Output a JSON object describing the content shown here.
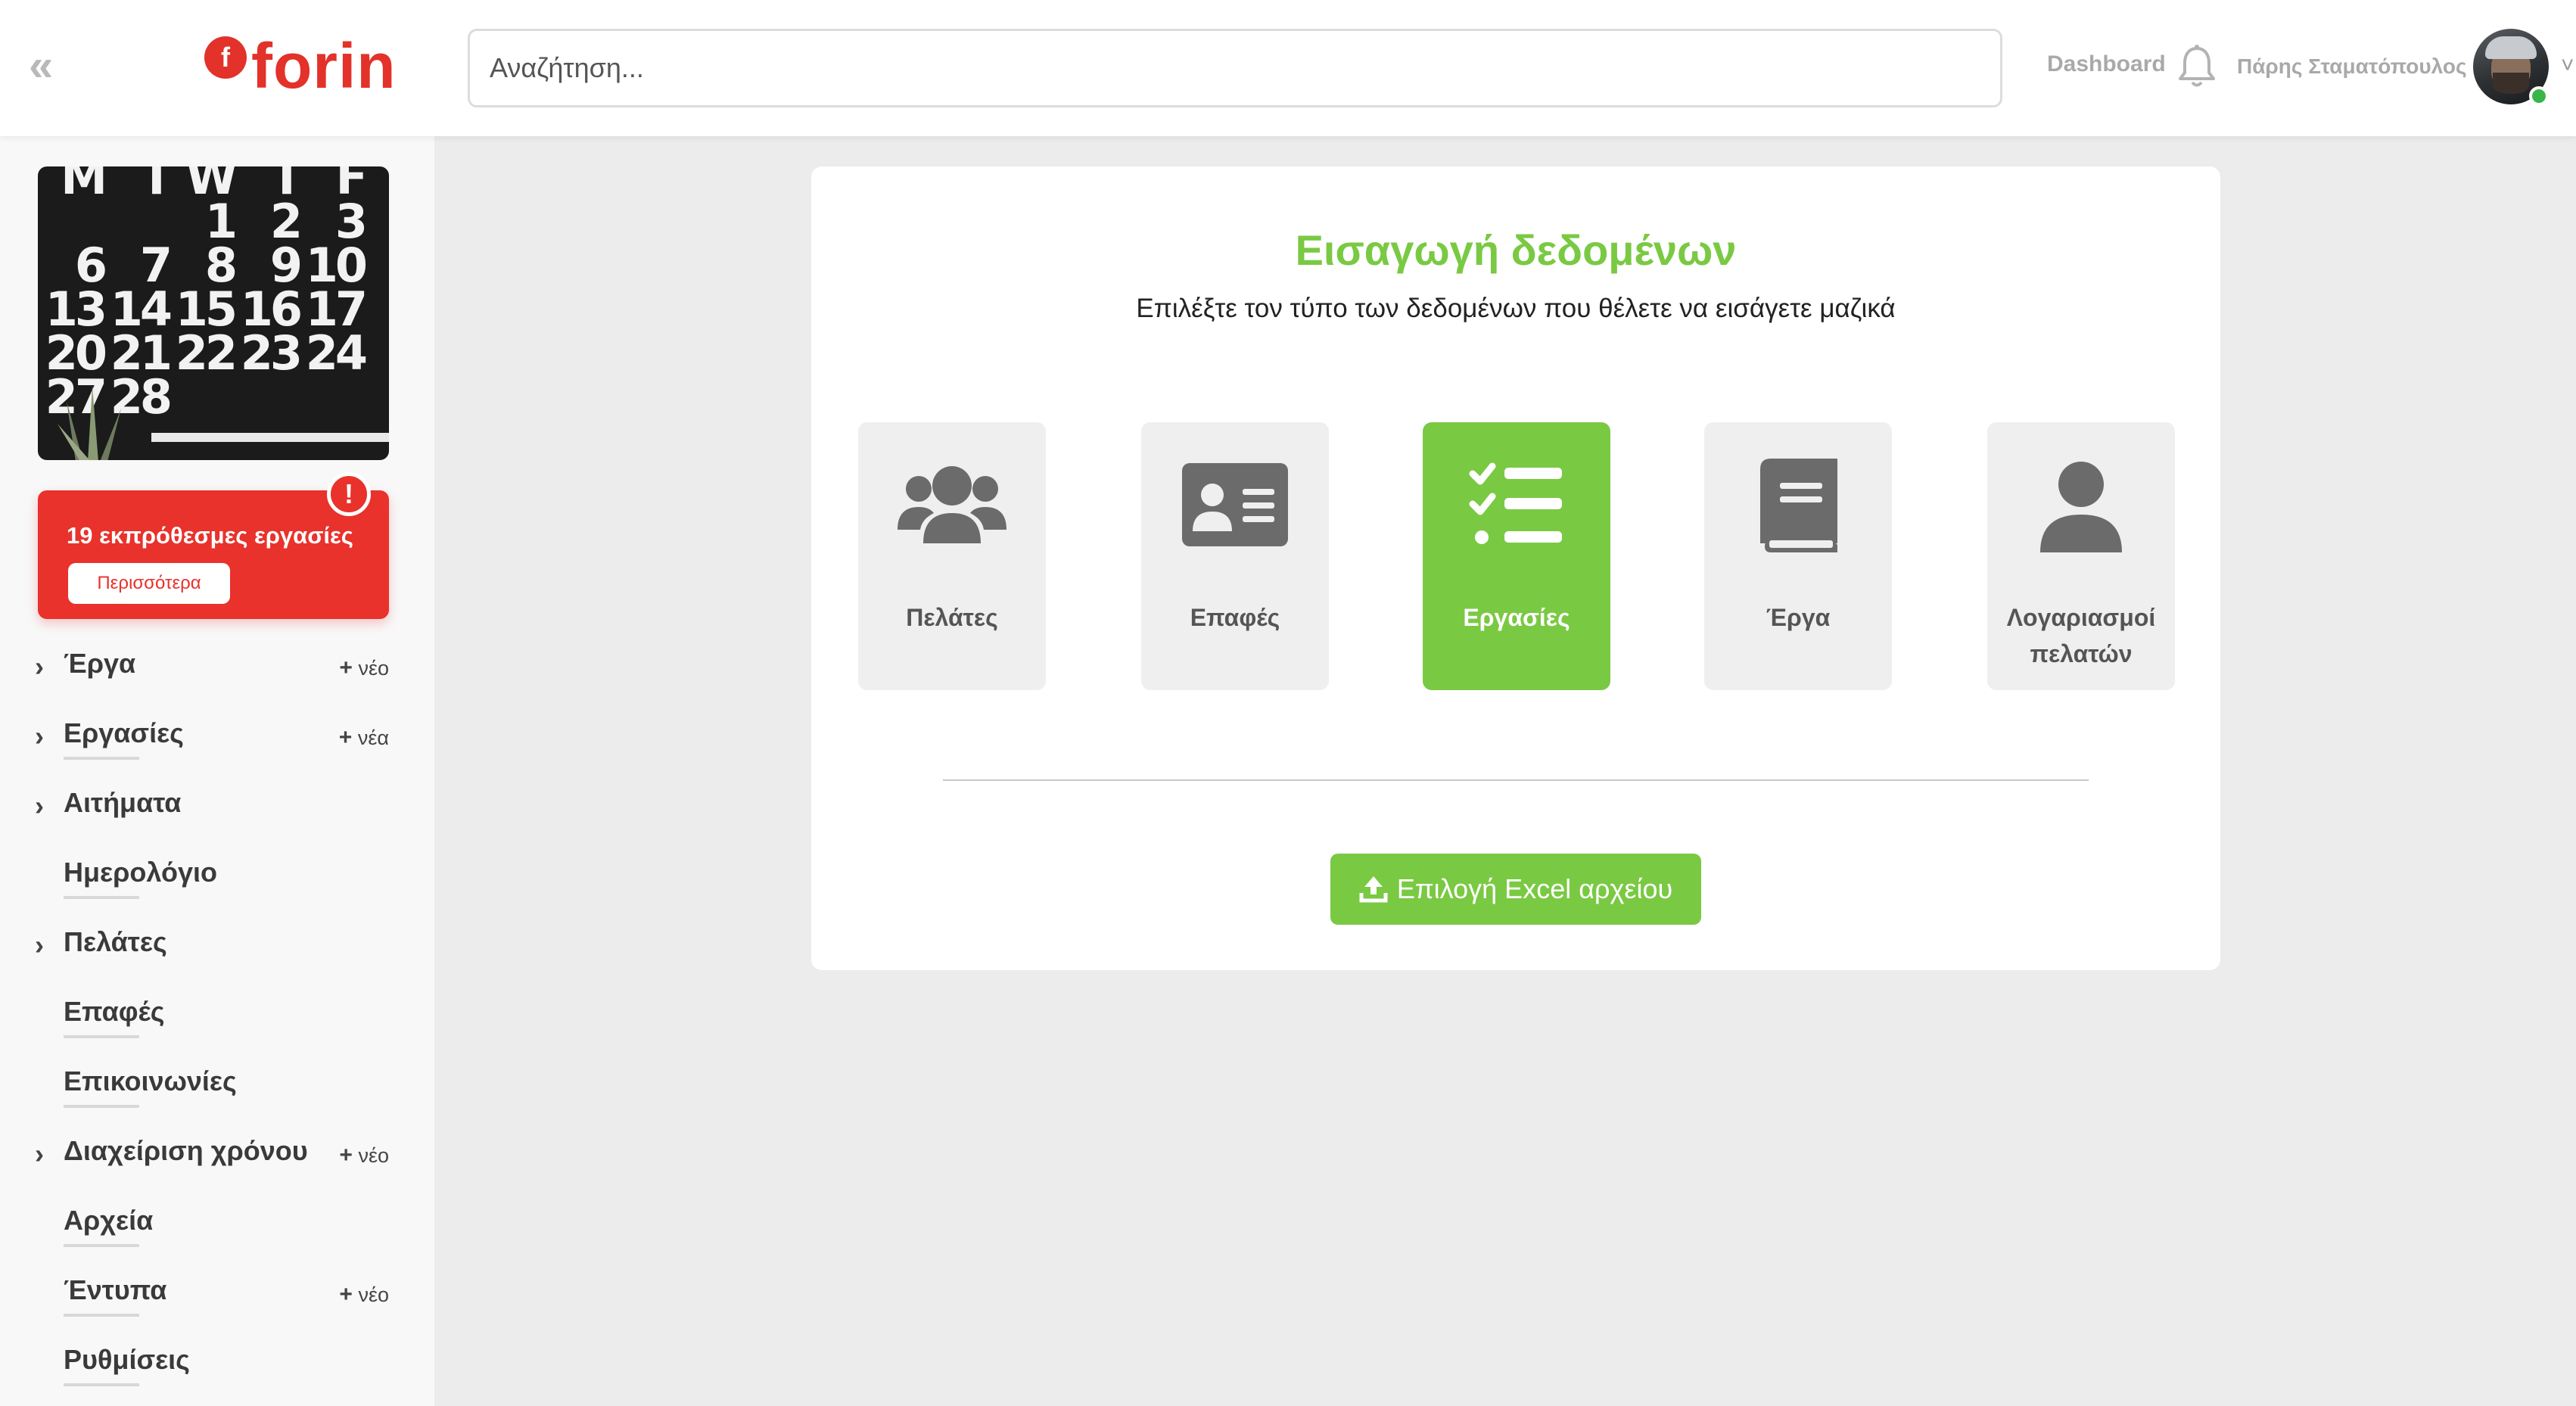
{
  "header": {
    "collapse_icon": "double-chevron-left-icon",
    "logo_mark": "f",
    "logo_text": "forin",
    "search_placeholder": "Αναζήτηση...",
    "dashboard_link": "Dashboard",
    "user_name": "Πάρης Σταματόπουλος",
    "caret": "˅"
  },
  "sidebar": {
    "calendar_numbers": [
      "M",
      "T",
      "W",
      "T",
      "F",
      "",
      "",
      "1",
      "2",
      "3",
      "6",
      "7",
      "8",
      "9",
      "10",
      "13",
      "14",
      "15",
      "16",
      "17",
      "20",
      "21",
      "22",
      "23",
      "24",
      "27",
      "28",
      "",
      "",
      ""
    ],
    "overdue": {
      "text": "19 εκπρόθεσμες εργασίες",
      "button": "Περισσότερα",
      "badge": "!"
    },
    "items": [
      {
        "label": "Έργα",
        "chevron": "›",
        "new": "νέο"
      },
      {
        "label": "Εργασίες",
        "chevron": "›",
        "new": "νέα"
      },
      {
        "label": "Αιτήματα",
        "chevron": "›",
        "new": ""
      },
      {
        "label": "Ημερολόγιο",
        "chevron": "",
        "new": ""
      },
      {
        "label": "Πελάτες",
        "chevron": "›",
        "new": ""
      },
      {
        "label": "Επαφές",
        "chevron": "",
        "new": ""
      },
      {
        "label": "Επικοινωνίες",
        "chevron": "",
        "new": ""
      },
      {
        "label": "Διαχείριση χρόνου",
        "chevron": "›",
        "new": "νέο"
      },
      {
        "label": "Αρχεία",
        "chevron": "",
        "new": ""
      },
      {
        "label": "Έντυπα",
        "chevron": "",
        "new": "νέο"
      },
      {
        "label": "Ρυθμίσεις",
        "chevron": "",
        "new": ""
      }
    ],
    "plus": "+"
  },
  "main": {
    "title": "Εισαγωγή δεδομένων",
    "subtitle": "Επιλέξτε τον τύπο των δεδομένων που θέλετε να εισάγετε μαζικά",
    "types": [
      {
        "label": "Πελάτες",
        "icon": "users-group-icon",
        "active": false
      },
      {
        "label": "Επαφές",
        "icon": "contact-card-icon",
        "active": false
      },
      {
        "label": "Εργασίες",
        "icon": "checklist-icon",
        "active": true
      },
      {
        "label": "Έργα",
        "icon": "book-icon",
        "active": false
      },
      {
        "label": "Λογαριασμοί πελατών",
        "icon": "user-icon",
        "active": false
      }
    ],
    "excel_button": "Επιλογή Excel αρχείου"
  },
  "colors": {
    "brand_red": "#e8322b",
    "accent_green": "#7ac943",
    "tile_bg": "#efefef",
    "icon_grey": "#6b6b6b"
  }
}
